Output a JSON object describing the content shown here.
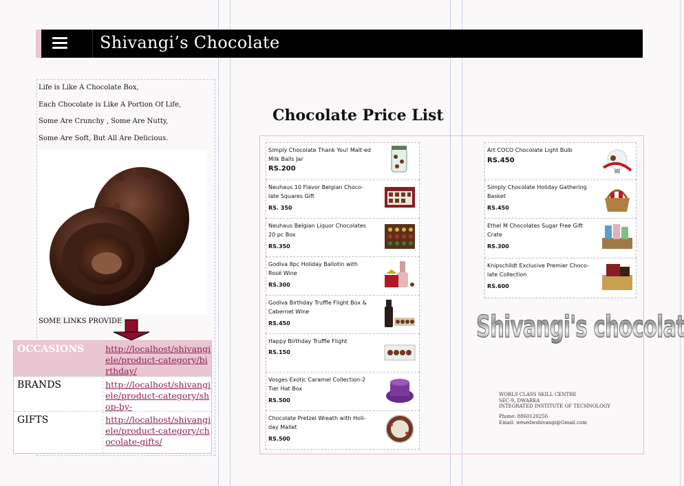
{
  "header": {
    "title": "Shivangi’s Chocolate",
    "menu_icon": "hamburger-icon"
  },
  "poem": [
    "Life is Like A Chocolate Box,",
    "Each Chocolate is Like A Portion Of Life,",
    "Some Are Crunchy , Some Are Nutty,",
    "Some Are Soft, But All Are Delicious."
  ],
  "links": {
    "label": "SOME LINKS PROVIDE",
    "rows": [
      {
        "name": "OCCASIONS",
        "url": "http://localhost/shivangiele/product-category/birthday/"
      },
      {
        "name": "BRANDS",
        "url": "http://localhost/shivangiele/product-category/shop-by-"
      },
      {
        "name": "GIFTS",
        "url": "http://localhost/shivangiele/product-category/chocolate-gifts/"
      }
    ]
  },
  "price_list": {
    "title": "Chocolate Price List",
    "left": [
      {
        "name": "Simply Chocolate Thank You! Malt-ed Milk Balls Jar",
        "price": "RS.200"
      },
      {
        "name": "Neuhaus 10 Flavor Belgian Choco-late Squares Gift",
        "price": "RS. 350"
      },
      {
        "name": "Neuhaus Belgian Liquor Chocolates 20 pc Box",
        "price": "RS.350"
      },
      {
        "name": "Godiva 8pc Holiday Ballotin with Rosé Wine",
        "price": "RS.300"
      },
      {
        "name": "Godiva Birthday Truffle Flight Box & Cabernet Wine",
        "price": "RS.450"
      },
      {
        "name": "Happy Birthday Truffle Flight",
        "price": "RS.150"
      },
      {
        "name": "Vosges Exotic Caramel Collection-2 Tier Hat Box",
        "price": "RS.500"
      },
      {
        "name": "Chocolate Pretzel Wreath with Holi-day Mallet",
        "price": "RS.500"
      }
    ],
    "right": [
      {
        "name": "Art COCO Chocolate Light Bulb",
        "price": "RS.450"
      },
      {
        "name": "Simply Chocolate Holiday Gathering Basket",
        "price": "RS.450"
      },
      {
        "name": "Ethel M Chocolates Sugar Free Gift Crate",
        "price": "RS.300"
      },
      {
        "name": "Knipschildt Exclusive Premier Choco-late Collection",
        "price": "RS.600"
      }
    ]
  },
  "wordart": "Shivangi's chocolate",
  "address": [
    "WORLS CLASS SKILL CENTRE",
    "SEC-9, DWARKA",
    "INTEGRATED INSTITUTE OF TECHNOLOGY"
  ],
  "contact": {
    "phone": "Phone: 8860120256",
    "email": "Email: wesedwshivangi@Gmail.com"
  }
}
